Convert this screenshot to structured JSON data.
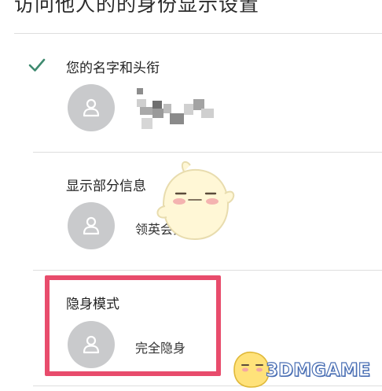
{
  "page": {
    "title": "访问他人的的身份显示设置"
  },
  "options": [
    {
      "title": "您的名字和头衔",
      "value": "",
      "selected": true,
      "value_obscured": true
    },
    {
      "title": "显示部分信息",
      "value": "领英会员",
      "selected": false
    },
    {
      "title": "隐身模式",
      "value": "完全隐身",
      "selected": false,
      "highlighted": true
    }
  ],
  "colors": {
    "check": "#3e8a6f",
    "avatar_bg": "#c9cacc",
    "highlight": "#e84c6c",
    "divider": "#dedede",
    "watermark_stroke": "#4a6fb4"
  },
  "icons": {
    "check": "check-icon",
    "avatar": "person-silhouette-icon"
  },
  "watermark": {
    "text": "3DMGAME"
  }
}
